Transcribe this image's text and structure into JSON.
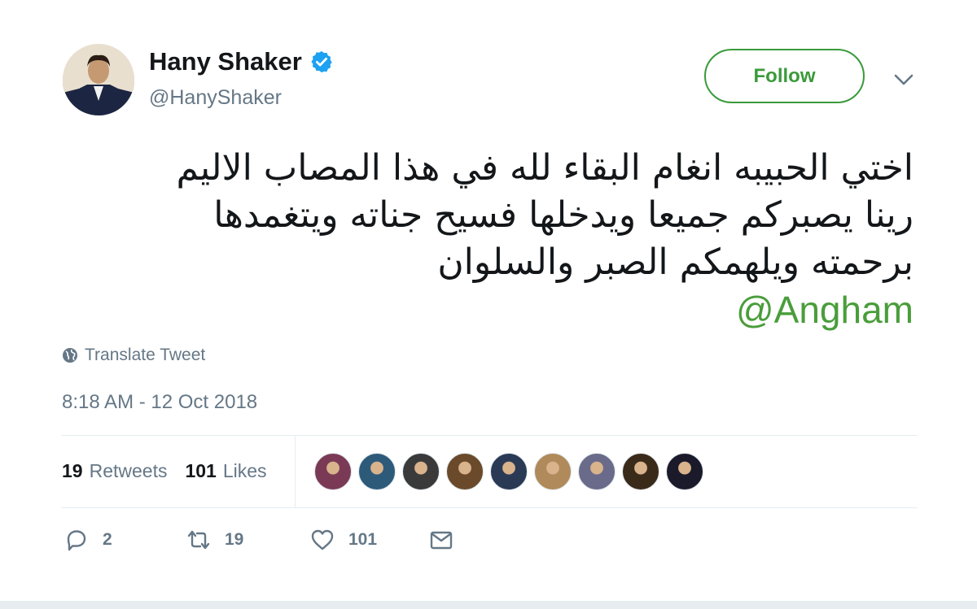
{
  "user": {
    "name": "Hany Shaker",
    "handle": "@HanyShaker",
    "verified": true
  },
  "header": {
    "follow_label": "Follow"
  },
  "tweet": {
    "lines": [
      "اختي الحبيبه انغام البقاء لله في هذا المصاب الاليم",
      "رينا يصبركم جميعا ويدخلها فسيح جناته ويتغمدها",
      "برحمته ويلهمكم الصبر والسلوان"
    ],
    "mention": "@Angham",
    "translate_label": "Translate Tweet",
    "timestamp": "8:18 AM - 12 Oct 2018"
  },
  "stats": {
    "retweets_count": "19",
    "retweets_label": "Retweets",
    "likes_count": "101",
    "likes_label": "Likes"
  },
  "likers": [
    {
      "name": "liker-1",
      "color": "#7a3a55"
    },
    {
      "name": "liker-2",
      "color": "#2e5a7a"
    },
    {
      "name": "liker-3",
      "color": "#3a3a3a"
    },
    {
      "name": "liker-4",
      "color": "#6a4a2a"
    },
    {
      "name": "liker-5",
      "color": "#2a3a55"
    },
    {
      "name": "liker-6",
      "color": "#b08a5a"
    },
    {
      "name": "liker-7",
      "color": "#6a6a8a"
    },
    {
      "name": "liker-8",
      "color": "#3a2a1a"
    },
    {
      "name": "liker-9",
      "color": "#1a1a2a"
    }
  ],
  "actions": {
    "replies": "2",
    "retweets": "19",
    "likes": "101"
  },
  "colors": {
    "accent_green": "#4a9d3b",
    "verified_blue": "#1da1f2",
    "muted": "#657786"
  },
  "icons": {
    "verified": "verified-badge-icon",
    "caret": "chevron-down-icon",
    "translate": "globe-icon",
    "reply": "reply-icon",
    "retweet": "retweet-icon",
    "like": "heart-icon",
    "dm": "envelope-icon"
  }
}
